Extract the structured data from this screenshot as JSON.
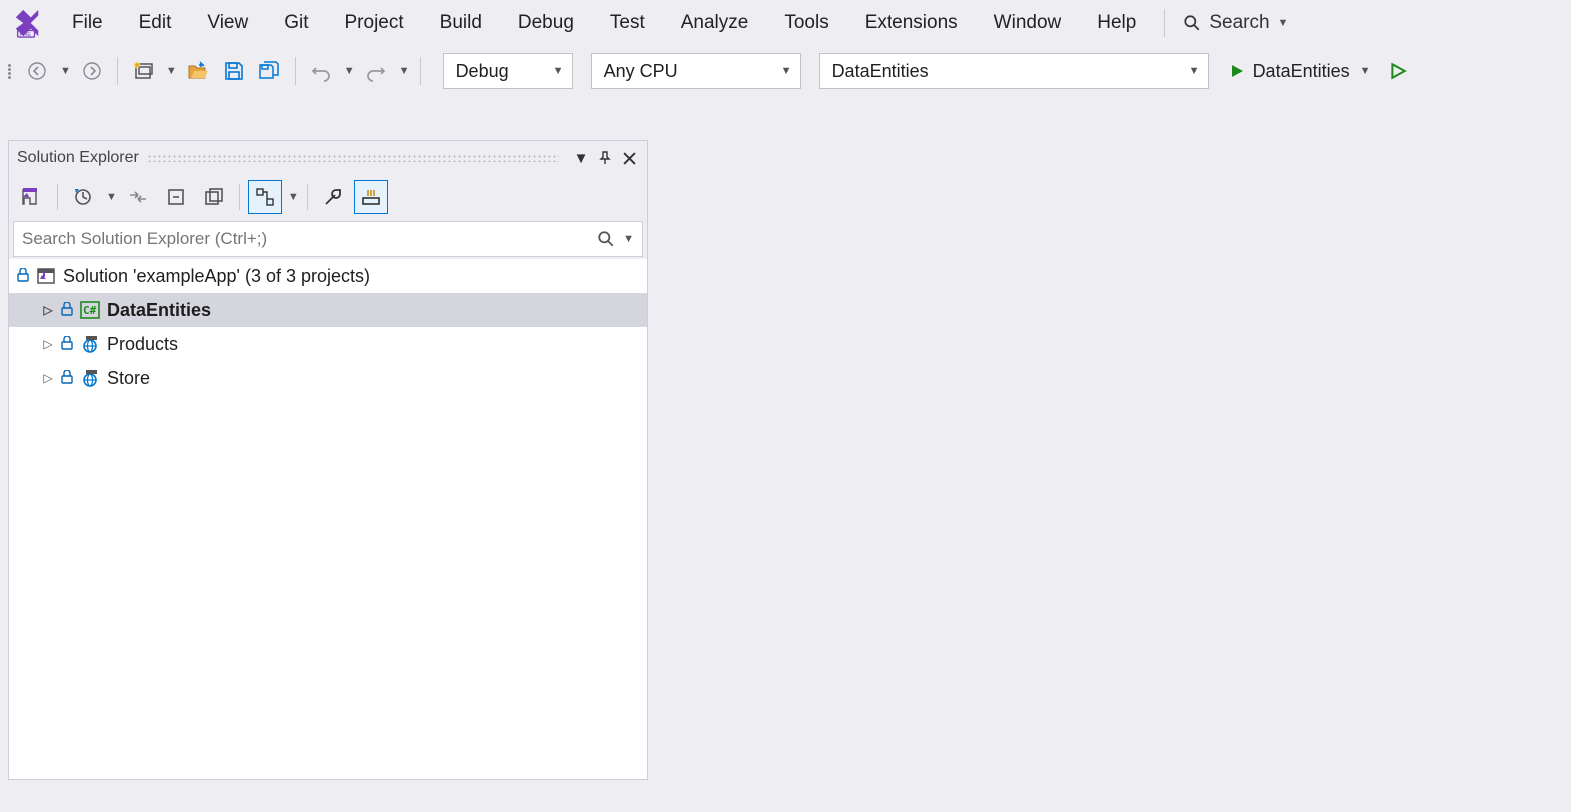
{
  "menubar": {
    "items": [
      "File",
      "Edit",
      "View",
      "Git",
      "Project",
      "Build",
      "Debug",
      "Test",
      "Analyze",
      "Tools",
      "Extensions",
      "Window",
      "Help"
    ],
    "search_label": "Search"
  },
  "toolbar": {
    "config_dropdown": "Debug",
    "platform_dropdown": "Any CPU",
    "startup_dropdown": "DataEntities",
    "run_label": "DataEntities"
  },
  "solution_explorer": {
    "title": "Solution Explorer",
    "search_placeholder": "Search Solution Explorer (Ctrl+;)",
    "tree": {
      "solution_label": "Solution 'exampleApp' (3 of 3 projects)",
      "projects": [
        {
          "name": "DataEntities",
          "selected": true,
          "type": "csharp"
        },
        {
          "name": "Products",
          "selected": false,
          "type": "web"
        },
        {
          "name": "Store",
          "selected": false,
          "type": "web"
        }
      ]
    }
  }
}
